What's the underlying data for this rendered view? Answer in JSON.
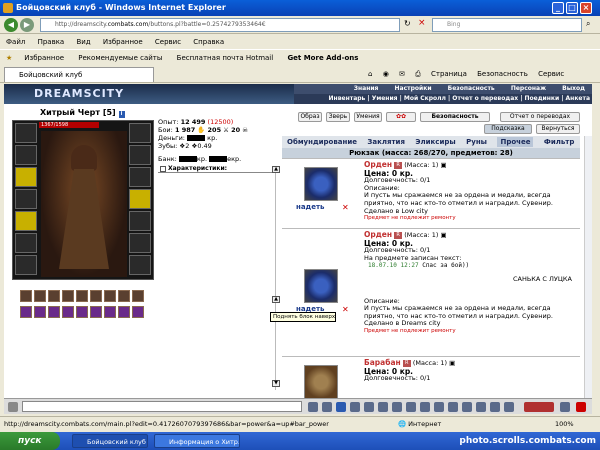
{
  "window": {
    "title": "Бойцовский клуб - Windows Internet Explorer"
  },
  "address": {
    "url_gray": "http://dreamscity.",
    "url_host": "combats.com",
    "url_rest": "/buttons.pl?battle=0.2574279353464€",
    "search_placeholder": "Bing"
  },
  "menu": [
    "Файл",
    "Правка",
    "Вид",
    "Избранное",
    "Сервис",
    "Справка"
  ],
  "favbar": {
    "favorites": "Избранное",
    "suggested": "Рекомендуемые сайты",
    "hotmail": "Бесплатная почта Hotmail",
    "addons": "Get More Add-ons"
  },
  "tab": {
    "title": "Бойцовский клуб"
  },
  "tabtools": [
    "Страница",
    "Безопасность",
    "Сервис"
  ],
  "game": {
    "logo": "DREAMSCITY",
    "nav1": [
      "Знания",
      "Настройки",
      "Безопасность",
      "Персонаж",
      "Выход"
    ],
    "nav2": "Инвентарь | Умения | Мой Скролл | Отчет о переводах | Поединки | Анкета",
    "char_name": "Хитрый Черт",
    "char_level": "[5]",
    "hp": "1367/1598",
    "stats": {
      "exp_label": "Опыт:",
      "exp": "12 499",
      "exp_next": "(12500)",
      "battles_label": "Бои:",
      "battles": "1 987",
      "wins": "205",
      "losses": "20",
      "money_label": "Деньги:",
      "money_suffix": "кр.",
      "teeth_label": "Зубы:",
      "teeth": "2",
      "teeth2": "0.49",
      "bank_label": "Банк:",
      "bank_mid": "кр.",
      "bank_suffix": "екр."
    },
    "char_section": "Характеристики:",
    "tooltip": "Поднять блок наверх",
    "buttons": {
      "image": "Образ",
      "beast": "Зверь",
      "skills": "Умения",
      "bezop": "Безопасность",
      "report": "Отчет о переводах",
      "hint": "Подсказка",
      "back": "Вернуться"
    },
    "categories": [
      "Обмундирование",
      "Заклятия",
      "Эликсиры",
      "Руны",
      "Прочее",
      "Фильтр"
    ],
    "active_category": "Прочее",
    "backpack": "Рюкзак (масса: 268/270, предметов: 28)",
    "put_on": "надеть",
    "items": [
      {
        "name": "Орден",
        "mass": "(Масса: 1)",
        "price": "Цена: 0 кр.",
        "durability": "Долговечность: 0/1",
        "desc_label": "Описание:",
        "desc": "И пусть мы сражаемся не за ордена и медали, всегда приятно, что нас кто-то отметил и наградил. Сувенир.",
        "made": "Сделано в Low city",
        "repair": "Предмет не подлежит ремонту"
      },
      {
        "name": "Орден",
        "mass": "(Масса: 1)",
        "price": "Цена: 0 кр.",
        "durability": "Долговечность: 0/1",
        "engraved_label": "На предмете записан текст:",
        "engraved": "18.07.10 12:27",
        "engraved_msg": "Спас за бой))",
        "sig": "САНЬКА С ЛУЦКА",
        "desc_label": "Описание:",
        "desc": "И пусть мы сражаемся не за ордена и медали, всегда приятно, что нас кто-то отметил и наградил. Сувенир.",
        "made": "Сделано в Dreams city",
        "repair": "Предмет не подлежит ремонту"
      },
      {
        "name": "Барабан",
        "mass": "(Масса: 1)",
        "price": "Цена: 0 кр.",
        "durability": "Долговечность: 0/1"
      }
    ]
  },
  "status": {
    "url": "http://dreamscity.combats.com/main.pl?edit=0.4172607079397686&bar=power&a=up#bar_power",
    "zone": "Интернет",
    "zoom": "100%"
  },
  "taskbar": {
    "start": "пуск",
    "task1": "Бойцовский клуб - ...",
    "task2": "Информация о Хитр...",
    "watermark": "photo.scrolls.combats.com"
  }
}
